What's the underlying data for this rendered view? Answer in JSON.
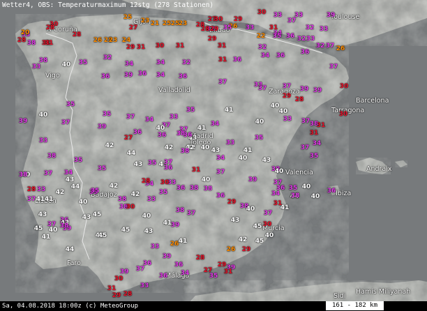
{
  "header": {
    "title": "Wetter4, OBS: Temperaturmaximum 12stg (278 Stationen)"
  },
  "footer": {
    "timestamp": "Sa, 04.08.2018 18:00z (c) MeteoGroup",
    "scale": "161 - 182 km"
  },
  "colors": {
    "sea": "#777a7c",
    "land": "#aeb0ac",
    "t_low": "#ff8c00",
    "t_mid": "#e8122a",
    "t_high": "#e23ae8",
    "t_max": "#ffffff"
  },
  "cities": [
    "Toulouse",
    "A Coruña",
    "Gijón",
    "Bilbao",
    "Vigo",
    "Valladolid",
    "Zaragoza",
    "Barcelona",
    "Tarragona",
    "Madrid",
    "Toledo",
    "Valencia",
    "Andraix",
    "Lisbon",
    "Badajoz",
    "Ibiza",
    "Murcia",
    "Faro",
    "Málaga",
    "Hamis Miliyanah",
    "Sidi"
  ],
  "stations": [
    {
      "t": "33"
    },
    {
      "t": "30"
    },
    {
      "t": "33"
    },
    {
      "t": "39"
    },
    {
      "t": "27"
    },
    {
      "t": "30"
    },
    {
      "t": "29"
    },
    {
      "t": "26"
    },
    {
      "t": "35"
    },
    {
      "t": "32"
    },
    {
      "t": "33"
    },
    {
      "t": "25"
    },
    {
      "t": "23"
    },
    {
      "t": "21"
    },
    {
      "t": "27"
    },
    {
      "t": "25"
    },
    {
      "t": "25"
    },
    {
      "t": "23"
    },
    {
      "t": "28"
    },
    {
      "t": "28"
    },
    {
      "t": "29"
    },
    {
      "t": "28"
    },
    {
      "t": "26"
    },
    {
      "t": "25"
    },
    {
      "t": "23"
    },
    {
      "t": "30"
    },
    {
      "t": "28"
    },
    {
      "t": "33"
    },
    {
      "t": "38"
    },
    {
      "t": "31"
    },
    {
      "t": "31"
    },
    {
      "t": "37"
    },
    {
      "t": "32"
    },
    {
      "t": "33"
    },
    {
      "t": "22"
    },
    {
      "t": "31"
    },
    {
      "t": "34"
    },
    {
      "t": "36"
    },
    {
      "t": "32"
    },
    {
      "t": "33"
    },
    {
      "t": "26"
    },
    {
      "t": "32"
    },
    {
      "t": "31"
    },
    {
      "t": "31"
    },
    {
      "t": "30"
    },
    {
      "t": "31"
    },
    {
      "t": "29"
    },
    {
      "t": "20"
    },
    {
      "t": "28"
    },
    {
      "t": "24"
    },
    {
      "t": "29"
    },
    {
      "t": "32"
    },
    {
      "t": "34"
    },
    {
      "t": "31"
    },
    {
      "t": "34"
    },
    {
      "t": "36"
    },
    {
      "t": "36"
    },
    {
      "t": "35"
    },
    {
      "t": "36"
    },
    {
      "t": "37"
    },
    {
      "t": "32"
    },
    {
      "t": "37"
    },
    {
      "t": "40"
    },
    {
      "t": "35"
    },
    {
      "t": "38"
    },
    {
      "t": "34"
    },
    {
      "t": "32"
    },
    {
      "t": "33"
    },
    {
      "t": "36"
    },
    {
      "t": "39"
    },
    {
      "t": "36"
    },
    {
      "t": "34"
    },
    {
      "t": "36"
    },
    {
      "t": "37"
    },
    {
      "t": "33"
    },
    {
      "t": "37"
    },
    {
      "t": "39"
    },
    {
      "t": "37"
    },
    {
      "t": "30"
    },
    {
      "t": "39"
    },
    {
      "t": "30"
    },
    {
      "t": "35"
    },
    {
      "t": "35"
    },
    {
      "t": "37"
    },
    {
      "t": "35"
    },
    {
      "t": "33"
    },
    {
      "t": "34"
    },
    {
      "t": "36"
    },
    {
      "t": "37"
    },
    {
      "t": "40"
    },
    {
      "t": "33"
    },
    {
      "t": "38"
    },
    {
      "t": "31"
    },
    {
      "t": "39"
    },
    {
      "t": "40"
    },
    {
      "t": "37"
    },
    {
      "t": "41"
    },
    {
      "t": "27"
    },
    {
      "t": "43"
    },
    {
      "t": "42"
    },
    {
      "t": "33"
    },
    {
      "t": "40"
    },
    {
      "t": "35"
    },
    {
      "t": "41"
    },
    {
      "t": "34"
    },
    {
      "t": "43"
    },
    {
      "t": "43"
    },
    {
      "t": "40"
    },
    {
      "t": "42"
    },
    {
      "t": "43"
    },
    {
      "t": "43"
    },
    {
      "t": "44"
    },
    {
      "t": "42"
    },
    {
      "t": "42"
    },
    {
      "t": "36"
    },
    {
      "t": "40"
    },
    {
      "t": "37"
    },
    {
      "t": "33"
    },
    {
      "t": "38"
    },
    {
      "t": "39"
    },
    {
      "t": "35"
    },
    {
      "t": "35"
    },
    {
      "t": "37"
    },
    {
      "t": "34"
    },
    {
      "t": "33"
    },
    {
      "t": "37"
    },
    {
      "t": "41"
    },
    {
      "t": "42"
    },
    {
      "t": "43"
    },
    {
      "t": "44"
    },
    {
      "t": "42"
    },
    {
      "t": "35"
    },
    {
      "t": "42"
    },
    {
      "t": "38"
    },
    {
      "t": "40"
    },
    {
      "t": "35"
    },
    {
      "t": "38"
    },
    {
      "t": "40"
    },
    {
      "t": "28"
    },
    {
      "t": "41"
    },
    {
      "t": "43"
    },
    {
      "t": "37"
    },
    {
      "t": "40"
    },
    {
      "t": "36"
    },
    {
      "t": "39"
    },
    {
      "t": "41"
    },
    {
      "t": "43"
    },
    {
      "t": "45"
    },
    {
      "t": "40"
    },
    {
      "t": "45"
    },
    {
      "t": "44"
    },
    {
      "t": "43"
    },
    {
      "t": "45"
    },
    {
      "t": "38"
    },
    {
      "t": "40"
    },
    {
      "t": "45"
    },
    {
      "t": "43"
    },
    {
      "t": "41"
    },
    {
      "t": "39"
    },
    {
      "t": "37"
    },
    {
      "t": "38"
    },
    {
      "t": "35"
    },
    {
      "t": "36"
    },
    {
      "t": "34"
    },
    {
      "t": "35"
    },
    {
      "t": "33"
    },
    {
      "t": "40"
    },
    {
      "t": "37"
    },
    {
      "t": "31"
    },
    {
      "t": "36"
    },
    {
      "t": "38"
    },
    {
      "t": "38"
    },
    {
      "t": "36"
    },
    {
      "t": "38"
    },
    {
      "t": "29"
    },
    {
      "t": "38"
    },
    {
      "t": "40"
    },
    {
      "t": "37"
    },
    {
      "t": "34"
    },
    {
      "t": "37"
    },
    {
      "t": "36"
    },
    {
      "t": "31"
    },
    {
      "t": "30"
    },
    {
      "t": "40"
    },
    {
      "t": "45"
    },
    {
      "t": "42"
    },
    {
      "t": "43"
    },
    {
      "t": "45"
    },
    {
      "t": "41"
    },
    {
      "t": "44"
    },
    {
      "t": "40"
    },
    {
      "t": "39"
    },
    {
      "t": "38"
    },
    {
      "t": "40"
    },
    {
      "t": "35"
    },
    {
      "t": "38"
    },
    {
      "t": "40"
    },
    {
      "t": "36"
    },
    {
      "t": "37"
    },
    {
      "t": "35"
    },
    {
      "t": "34"
    },
    {
      "t": "31"
    },
    {
      "t": "37"
    },
    {
      "t": "28"
    },
    {
      "t": "29"
    },
    {
      "t": "40"
    },
    {
      "t": "40"
    },
    {
      "t": "41"
    },
    {
      "t": "34"
    },
    {
      "t": "36"
    },
    {
      "t": "38"
    },
    {
      "t": "38"
    },
    {
      "t": "37"
    },
    {
      "t": "28"
    },
    {
      "t": "30"
    },
    {
      "t": "33"
    },
    {
      "t": "30"
    },
    {
      "t": "33"
    },
    {
      "t": "26"
    },
    {
      "t": "41"
    },
    {
      "t": "39"
    },
    {
      "t": "37"
    },
    {
      "t": "36"
    },
    {
      "t": "39"
    },
    {
      "t": "30"
    },
    {
      "t": "31"
    },
    {
      "t": "29"
    },
    {
      "t": "28"
    },
    {
      "t": "33"
    },
    {
      "t": "36"
    },
    {
      "t": "36"
    },
    {
      "t": "34"
    },
    {
      "t": "27"
    },
    {
      "t": "26"
    },
    {
      "t": "39"
    },
    {
      "t": "31"
    },
    {
      "t": "29"
    },
    {
      "t": "35"
    },
    {
      "t": "28"
    },
    {
      "t": "29"
    }
  ]
}
